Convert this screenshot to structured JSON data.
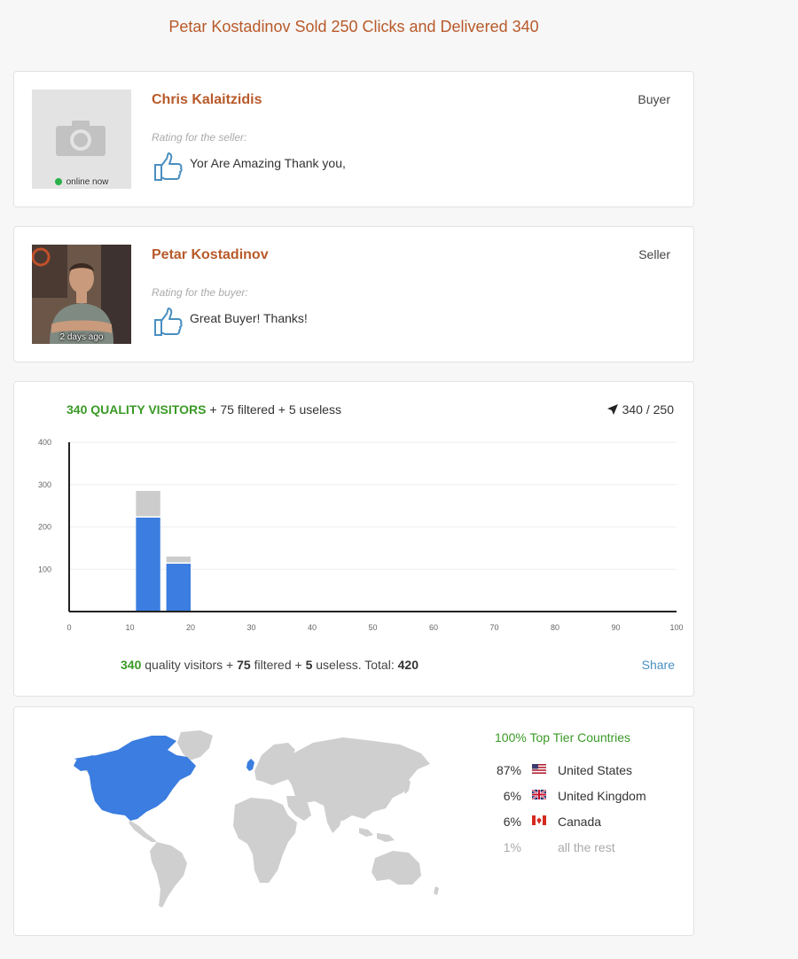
{
  "page": {
    "title": "Petar Kostadinov Sold 250 Clicks and Delivered 340"
  },
  "reviews": [
    {
      "name": "Chris Kalaitzidis",
      "role": "Buyer",
      "rating_label": "Rating for the seller:",
      "comment": "Yor Are Amazing Thank you,",
      "status": "online now",
      "photo": "camera-placeholder-icon"
    },
    {
      "name": "Petar Kostadinov",
      "role": "Seller",
      "rating_label": "Rating for the buyer:",
      "comment": "Great Buyer! Thanks!",
      "status": "2 days ago",
      "photo": "profile-photo"
    }
  ],
  "stats": {
    "header_quality": "340 QUALITY VISITORS",
    "header_rest": "+ 75 filtered + 5 useless",
    "delivered_ratio": "340 / 250",
    "footer": {
      "quality": "340",
      "quality_text": "quality visitors +",
      "filtered": "75",
      "filtered_text": "filtered +",
      "useless": "5",
      "useless_text": "useless. Total:",
      "total": "420"
    },
    "share_label": "Share"
  },
  "chart_data": {
    "type": "bar",
    "stacked": true,
    "x_ticks": [
      0,
      10,
      20,
      30,
      40,
      50,
      60,
      70,
      80,
      90,
      100
    ],
    "y_ticks": [
      100,
      200,
      300,
      400
    ],
    "xlim": [
      0,
      100
    ],
    "ylim": [
      0,
      400
    ],
    "bars": [
      {
        "x_start": 11,
        "x_end": 15,
        "quality": 222,
        "filtered": 63
      },
      {
        "x_start": 16,
        "x_end": 20,
        "quality": 113,
        "filtered": 17
      }
    ],
    "colors": {
      "quality": "#3b7de0",
      "filtered": "#cccccc"
    },
    "grid": true
  },
  "geo": {
    "title": "100% Top Tier Countries",
    "countries": [
      {
        "pct": "87%",
        "name": "United States",
        "flag": "us-flag-icon"
      },
      {
        "pct": "6%",
        "name": "United Kingdom",
        "flag": "uk-flag-icon"
      },
      {
        "pct": "6%",
        "name": "Canada",
        "flag": "ca-flag-icon"
      },
      {
        "pct": "1%",
        "name": "all the rest",
        "flag": ""
      }
    ],
    "highlight_color": "#3b7de0",
    "land_color": "#cfcfcf"
  }
}
